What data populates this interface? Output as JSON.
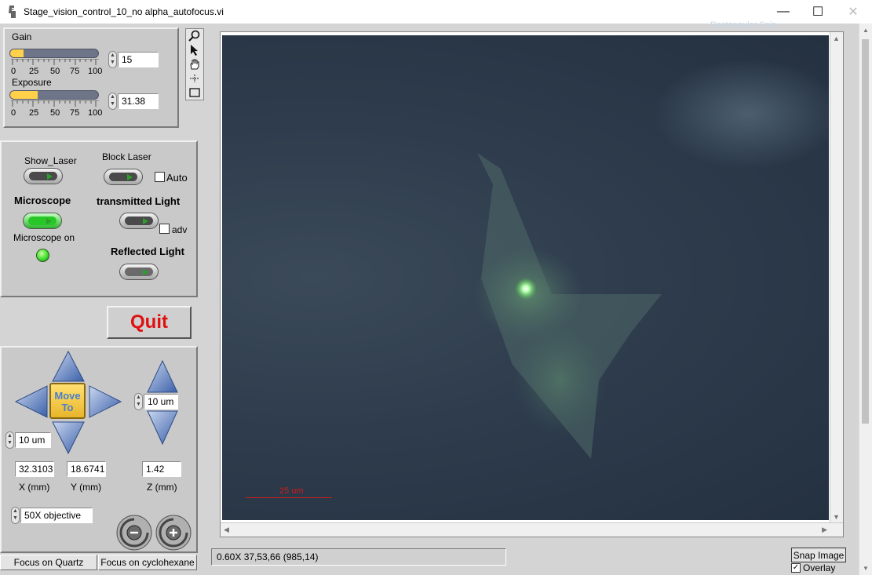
{
  "window": {
    "title": "Stage_vision_control_10_no alpha_autofocus.vi",
    "ghost_snip": "Rectangular Snip",
    "controls": {
      "minimize": "—",
      "maximize": "☐",
      "close": "✕"
    }
  },
  "camera": {
    "gain": {
      "label": "Gain",
      "value": "15",
      "fill_fraction": 0.15,
      "ticks": [
        "0",
        "25",
        "50",
        "75",
        "100"
      ]
    },
    "exposure": {
      "label": "Exposure",
      "value": "31.38",
      "fill_fraction": 0.31,
      "ticks": [
        "0",
        "25",
        "50",
        "75",
        "100"
      ]
    }
  },
  "tools": [
    "zoom-icon",
    "pointer-icon",
    "pan-hand-icon",
    "crosshair-icon",
    "rectangle-roi-icon"
  ],
  "illumination": {
    "show_laser": "Show_Laser",
    "block_laser": "Block Laser",
    "auto": "Auto",
    "microscope": "Microscope",
    "microscope_on": "Microscope on",
    "transmitted_light": "transmitted Light",
    "adv": "adv",
    "reflected_light": "Reflected Light",
    "microscope_state": true,
    "indicator_color": "#3fdc2e"
  },
  "quit": {
    "label": "Quit",
    "color": "#e01010"
  },
  "stage": {
    "move_to": "Move To",
    "xy_step": "10 um",
    "z_step": "10 um",
    "x_mm": "32.3103",
    "y_mm": "18.6741",
    "z_mm": "1.42",
    "x_label": "X (mm)",
    "y_label": "Y (mm)",
    "z_label": "Z (mm)",
    "objective": "50X objective",
    "focus_minus_icon": "minus-rotate-icon",
    "focus_plus_icon": "plus-rotate-icon"
  },
  "focus_buttons": {
    "quartz": "Focus on Quartz",
    "cyclohexane": "Focus on cyclohexane"
  },
  "image": {
    "scale_bar": "25 um",
    "scale_color": "#d21c1c"
  },
  "status": {
    "readout": "0.60X 37,53,66     (985,14)"
  },
  "snap": {
    "label": "Snap Image",
    "overlay": "Overlay",
    "overlay_checked": true
  }
}
